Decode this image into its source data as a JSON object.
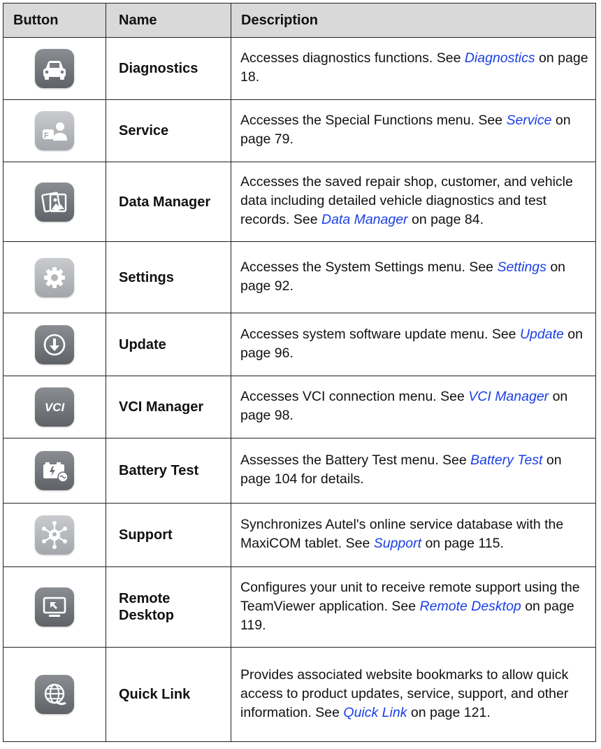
{
  "headers": {
    "button": "Button",
    "name": "Name",
    "description": "Description"
  },
  "rows": [
    {
      "icon": "car-icon",
      "name": "Diagnostics",
      "desc_before": "Accesses diagnostics functions. See ",
      "link": "Diagnostics",
      "desc_after": " on page 18."
    },
    {
      "icon": "service-person-icon",
      "name": "Service",
      "desc_before": "Accesses the Special Functions menu. See ",
      "link": "Service",
      "desc_after": " on page 79."
    },
    {
      "icon": "photos-icon",
      "name": "Data Manager",
      "desc_before": "Accesses the saved repair shop, customer, and vehicle data including detailed vehicle diagnostics and test records. See ",
      "link": "Data Manager",
      "desc_after": " on page 84."
    },
    {
      "icon": "gear-icon",
      "name": "Settings",
      "desc_before": "Accesses the System Settings menu. See ",
      "link": "Settings",
      "desc_after": " on page 92."
    },
    {
      "icon": "download-arrow-icon",
      "name": "Update",
      "desc_before": "Accesses system software update menu. See ",
      "link": "Update",
      "desc_after": " on page 96."
    },
    {
      "icon": "vci-icon",
      "icon_text": "VCI",
      "name": "VCI Manager",
      "desc_before": "Accesses VCI connection menu. See ",
      "link": "VCI Manager",
      "desc_after": " on page 98."
    },
    {
      "icon": "battery-icon",
      "name": "Battery Test",
      "desc_before": "Assesses the Battery Test menu. See ",
      "link": "Battery Test",
      "desc_after": " on page 104 for details."
    },
    {
      "icon": "network-hub-icon",
      "name": "Support",
      "desc_before": "Synchronizes Autel's online service database with the MaxiCOM tablet. See ",
      "link": "Support",
      "desc_after": " on page 115."
    },
    {
      "icon": "monitor-icon",
      "name": "Remote Desktop",
      "desc_before": "Configures your unit to receive remote support using the TeamViewer application. See ",
      "link": "Remote Desktop",
      "desc_after": " on page 119."
    },
    {
      "icon": "globe-link-icon",
      "name": "Quick Link",
      "desc_before": "Provides associated website bookmarks to allow quick access to product updates, service, support, and other information. See ",
      "link": "Quick Link",
      "desc_after": " on page 121."
    }
  ]
}
